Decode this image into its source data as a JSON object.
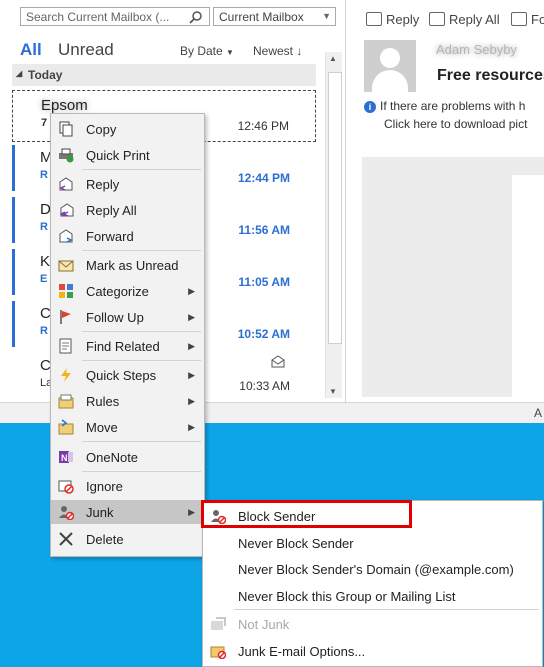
{
  "search": {
    "placeholder": "Search Current Mailbox (...",
    "scope": "Current Mailbox"
  },
  "filters": {
    "all": "All",
    "unread": "Unread",
    "sort_by": "By Date",
    "sort_order": "Newest"
  },
  "group_header": "Today",
  "messages": [
    {
      "sender": "Epsom",
      "sub": "7",
      "time": "12:46 PM"
    },
    {
      "sender": "M",
      "sub": "R",
      "time": "12:44 PM"
    },
    {
      "sender": "D",
      "sub": "R",
      "time": "11:56 AM"
    },
    {
      "sender": "K",
      "sub": "E",
      "time": "11:05 AM"
    },
    {
      "sender": "C",
      "sub": "R",
      "time": "10:52 AM"
    },
    {
      "sender": "C",
      "sub": "La",
      "time": "10:33 AM"
    }
  ],
  "reading": {
    "reply": "Reply",
    "reply_all": "Reply All",
    "forward": "Fo",
    "sender": "Adam Sebyby",
    "subject": "Free resources",
    "info_line1": "If there are problems with h",
    "info_line2": "Click here to download pict"
  },
  "status": {
    "right": "A"
  },
  "context_menu": [
    {
      "label": "Copy",
      "icon": "copy-icon"
    },
    {
      "label": "Quick Print",
      "icon": "print-icon"
    },
    {
      "label": "Reply",
      "icon": "reply-icon"
    },
    {
      "label": "Reply All",
      "icon": "reply-all-icon"
    },
    {
      "label": "Forward",
      "icon": "forward-icon"
    },
    {
      "label": "Mark as Unread",
      "icon": "envelope-icon"
    },
    {
      "label": "Categorize",
      "icon": "category-icon",
      "submenu": true
    },
    {
      "label": "Follow Up",
      "icon": "flag-icon",
      "submenu": true
    },
    {
      "label": "Find Related",
      "icon": "find-icon",
      "submenu": true
    },
    {
      "label": "Quick Steps",
      "icon": "lightning-icon",
      "submenu": true
    },
    {
      "label": "Rules",
      "icon": "rules-icon",
      "submenu": true
    },
    {
      "label": "Move",
      "icon": "move-icon",
      "submenu": true
    },
    {
      "label": "OneNote",
      "icon": "onenote-icon"
    },
    {
      "label": "Ignore",
      "icon": "ignore-icon"
    },
    {
      "label": "Junk",
      "icon": "junk-icon",
      "submenu": true
    },
    {
      "label": "Delete",
      "icon": "delete-icon"
    }
  ],
  "junk_submenu": [
    {
      "label": "Block Sender",
      "icon": "block-sender-icon"
    },
    {
      "label": "Never Block Sender"
    },
    {
      "label": "Never Block Sender's Domain (@example.com)"
    },
    {
      "label": "Never Block this Group or Mailing List"
    },
    {
      "label": "Not Junk",
      "icon": "not-junk-icon",
      "disabled": true
    },
    {
      "label": "Junk E-mail Options...",
      "icon": "junk-options-icon"
    }
  ],
  "colors": {
    "accent": "#2a6fd1",
    "highlight_box": "#e00000",
    "desktop": "#0ea5e8"
  }
}
